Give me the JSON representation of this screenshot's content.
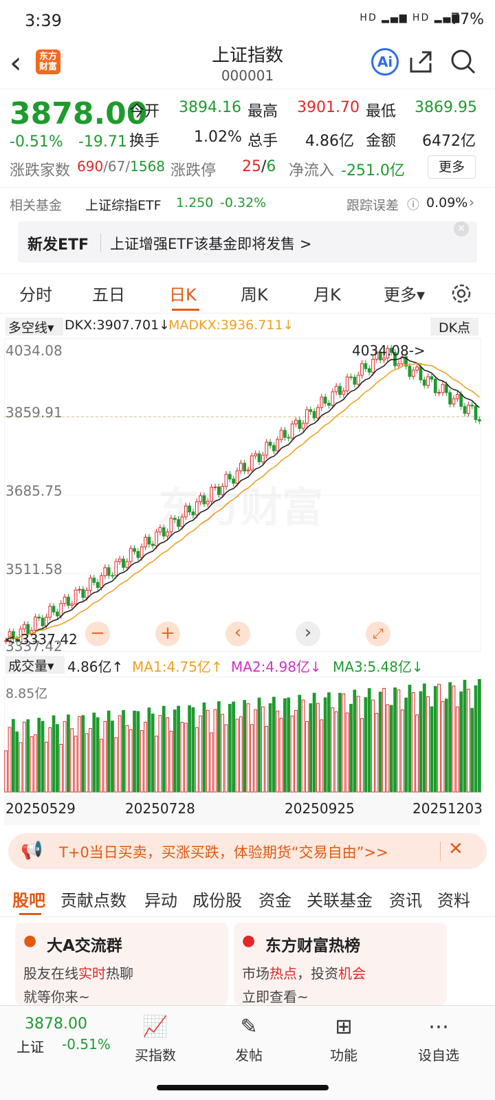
{
  "status": {
    "time": "3:39",
    "network": "HD ▂▄▆ HD ▂▄▆",
    "battery": "77%"
  },
  "header": {
    "back": "‹",
    "logo_line1": "东方",
    "logo_line2": "财富",
    "title": "上证指数",
    "code": "000001",
    "ai": "Ai"
  },
  "quote": {
    "price": "3878.00",
    "pct": "-0.51%",
    "chg": "-19.71",
    "open_label": "今开",
    "open": "3894.16",
    "high_label": "最高",
    "high": "3901.70",
    "low_label": "最低",
    "low": "3869.95",
    "turnover_label": "换手",
    "turnover": "1.02%",
    "vol_label": "总手",
    "vol": "4.86亿",
    "amt_label": "金额",
    "amt": "6472亿",
    "adv_label": "涨跌家数",
    "adv_up": "690",
    "adv_flat": "/67/",
    "adv_down": "1568",
    "limit_label": "涨跌停",
    "limit_up": "25",
    "limit_sep": "/",
    "limit_down": "6",
    "inflow_label": "净流入",
    "inflow": "-251.0亿",
    "more": "更多"
  },
  "fund": {
    "label": "相关基金",
    "name": "上证综指ETF",
    "price": "1.250",
    "pct": "-0.32%",
    "err_label": "跟踪误差",
    "err": "0.09%"
  },
  "banner": {
    "tag": "新发ETF",
    "text": "上证增强ETF该基金即将发售  >"
  },
  "tabs": [
    "分时",
    "五日",
    "日K",
    "周K",
    "月K",
    "更多▾"
  ],
  "kline": {
    "indicator": "多空线▾",
    "dkx": "DKX:3907.701↓",
    "madkx": "MADKX:3936.711↓",
    "dkpoint": "DK点",
    "y_labels": [
      "4034.08",
      "3859.91",
      "3685.75",
      "3511.58",
      "3337.42"
    ],
    "max_label": "4034.08->",
    "min_label": "<-3337.42",
    "watermark": "东方财富"
  },
  "volume": {
    "label": "成交量▾",
    "val": "4.86亿↑",
    "ma1": "MA1:4.75亿↑",
    "ma2": "MA2:4.98亿↓",
    "ma3": "MA3:5.48亿↓",
    "max": "8.85亿",
    "dates": [
      "20250529",
      "20250728",
      "20250925",
      "20251203"
    ]
  },
  "promo": {
    "text": "T+0当日买卖，买涨买跌，体验期货“交易自由”>>"
  },
  "subtabs": [
    "股吧",
    "贡献点数",
    "异动",
    "成份股",
    "资金",
    "关联基金",
    "资讯",
    "资料"
  ],
  "cards": [
    {
      "title": "大A交流群",
      "l1a": "股友在线",
      "l1b": "实时",
      "l1c": "热聊",
      "l2": "就等你来~"
    },
    {
      "title": "东方财富热榜",
      "l1a": "市场",
      "l1b": "热点",
      "l1c": "，投资",
      "l1d": "机会",
      "l2": "立即查看~"
    }
  ],
  "bottom": {
    "price": "3878.00",
    "name": "上证",
    "pct": "-0.51%",
    "items": [
      "买指数",
      "发帖",
      "功能",
      "设自选"
    ]
  },
  "chart_data": {
    "type": "candlestick",
    "title": "上证指数 日K",
    "ylim": [
      3337.42,
      4034.08
    ],
    "x": [
      "20250529",
      "20250728",
      "20250925",
      "20251203"
    ],
    "close_last": 3878.0,
    "high_max": 4034.08,
    "low_min": 3337.42
  }
}
